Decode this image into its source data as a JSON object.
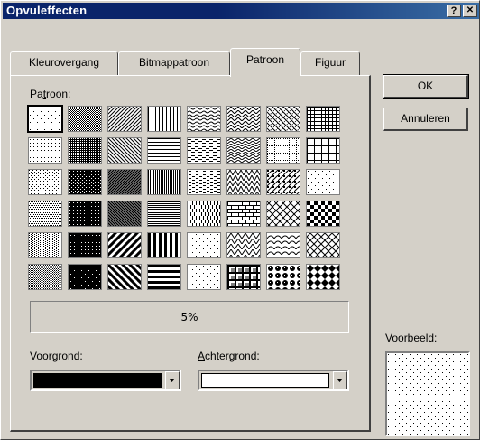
{
  "window": {
    "title": "Opvuleffecten",
    "help_button": "?",
    "close_button": "✕"
  },
  "tabs": [
    {
      "label": "Kleurovergang",
      "active": false
    },
    {
      "label": "Bitmappatroon",
      "active": false
    },
    {
      "label": "Patroon",
      "active": true
    },
    {
      "label": "Figuur",
      "active": false
    }
  ],
  "panel": {
    "pattern_label": "Patroon:",
    "selected_pattern": "5%",
    "foreground_label": "Voorgrond:",
    "background_label": "Achtergrond:",
    "foreground_color": "#000000",
    "background_color": "#ffffff"
  },
  "buttons": {
    "ok": "OK",
    "cancel": "Annuleren"
  },
  "preview": {
    "label": "Voorbeeld:"
  },
  "pattern_grid": {
    "rows": 6,
    "cols": 8,
    "selected_index": 0,
    "patterns": [
      "dots-5",
      "dots-50",
      "diag-right-light",
      "vert-light",
      "wave-horiz",
      "zigzag",
      "trellis",
      "grid-small",
      "dots-10",
      "dots-60",
      "diag-left-light",
      "horiz-light",
      "dash-horiz",
      "zigzag-dense",
      "grid-dotted",
      "grid-large",
      "dots-20",
      "dots-70",
      "diag-right-dark",
      "vert-dark",
      "dash-short",
      "diag-zig",
      "diag-check",
      "dots-dense",
      "dots-25",
      "dots-75",
      "diag-left-dark",
      "horiz-dark",
      "dash-vert",
      "brick",
      "weave",
      "checker",
      "dots-30",
      "dots-80",
      "diag-right-wide",
      "vert-wide",
      "dots-confetti",
      "zigzag-wide",
      "shingle",
      "diamond-outline",
      "dots-40",
      "dots-90",
      "diag-left-wide",
      "horiz-wide",
      "dots-small-confetti",
      "plaid",
      "sphere",
      "diamond-solid"
    ]
  }
}
